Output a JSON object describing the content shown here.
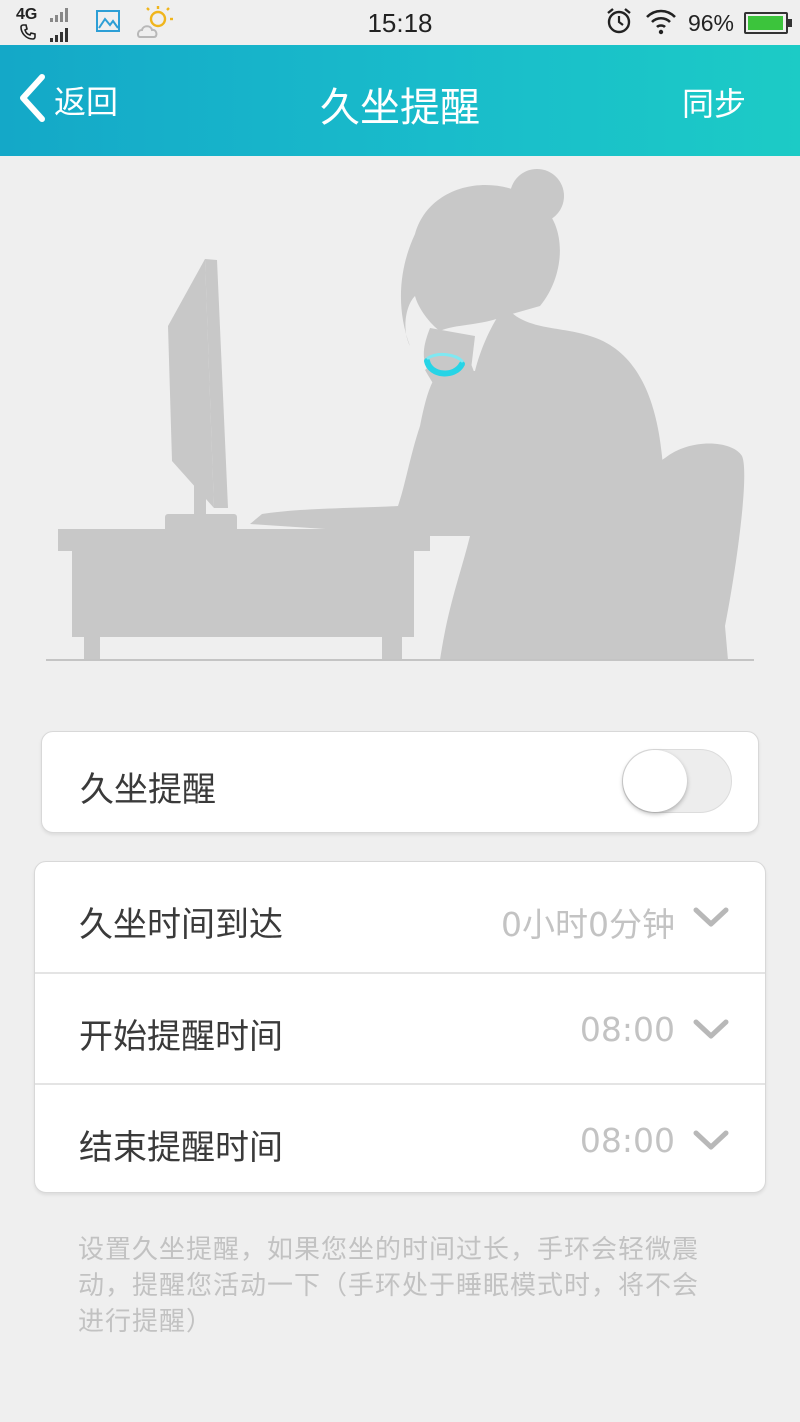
{
  "status_bar": {
    "network": "4G",
    "time": "15:18",
    "battery_percent": "96%",
    "battery_level": 0.96,
    "icons": [
      "phone-icon",
      "signal-icon",
      "gallery-icon",
      "weather-icon",
      "alarm-icon",
      "wifi-icon",
      "battery-icon"
    ]
  },
  "header": {
    "back_label": "返回",
    "title": "久坐提醒",
    "sync_label": "同步"
  },
  "toggle": {
    "label": "久坐提醒",
    "on": false
  },
  "settings": {
    "rows": [
      {
        "label": "久坐时间到达",
        "value": "0小时0分钟"
      },
      {
        "label": "开始提醒时间",
        "value": "08:00"
      },
      {
        "label": "结束提醒时间",
        "value": "08:00"
      }
    ]
  },
  "note": "设置久坐提醒，如果您坐的时间过长，手环会轻微震动，提醒您活动一下（手环处于睡眠模式时，将不会进行提醒）",
  "colors": {
    "header_start": "#14a8c8",
    "header_end": "#1ccbc6",
    "band": "#27d4e6",
    "silhouette": "#c8c8c8",
    "battery": "#3cc43c"
  }
}
